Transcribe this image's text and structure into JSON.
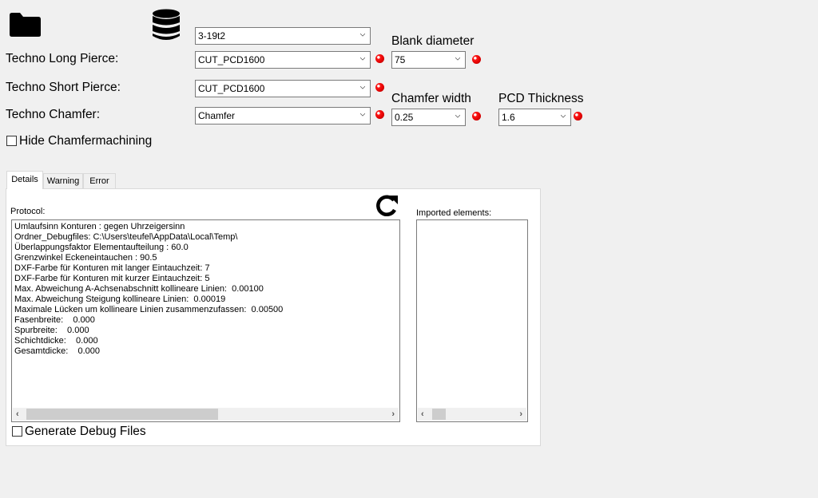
{
  "toolbar": {
    "folder_icon": "folder-icon",
    "database_icon": "database-icon"
  },
  "database_select": {
    "value": "3-19t2"
  },
  "fields": {
    "long_pierce": {
      "label": "Techno Long Pierce:",
      "value": "CUT_PCD1600"
    },
    "short_pierce": {
      "label": "Techno Short Pierce:",
      "value": "CUT_PCD1600"
    },
    "chamfer": {
      "label": "Techno Chamfer:",
      "value": "Chamfer"
    },
    "blank_diameter": {
      "label": "Blank diameter",
      "value": "75"
    },
    "chamfer_width": {
      "label": "Chamfer width",
      "value": "0.25"
    },
    "pcd_thickness": {
      "label": "PCD Thickness",
      "value": "1.6"
    }
  },
  "status_color": "#e00000",
  "hide_chamfer": {
    "label": "Hide Chamfermachining",
    "checked": false
  },
  "tabs": [
    {
      "label": "Details",
      "active": true
    },
    {
      "label": "Warning",
      "active": false
    },
    {
      "label": "Error",
      "active": false
    }
  ],
  "details": {
    "protocol_label": "Protocol:",
    "imported_label": "Imported elements:",
    "refresh_icon": "refresh-icon",
    "protocol_lines": [
      "Umlaufsinn Konturen : gegen Uhrzeigersinn",
      "Ordner_Debugfiles: C:\\Users\\teufel\\AppData\\Local\\Temp\\",
      "Überlappungsfaktor Elementaufteilung : 60.0",
      "Grenzwinkel Eckeneintauchen : 90.5",
      "DXF-Farbe für Konturen mit langer Eintauchzeit: 7",
      "DXF-Farbe für Konturen mit kurzer Eintauchzeit: 5",
      "Max. Abweichung A-Achsenabschnitt kollineare Linien:  0.00100",
      "Max. Abweichung Steigung kollineare Linien:  0.00019",
      "Maximale Lücken um kollineare Linien zusammenzufassen:  0.00500",
      "Fasenbreite:    0.000",
      "Spurbreite:    0.000",
      "Schichtdicke:    0.000",
      "Gesamtdicke:    0.000"
    ],
    "generate_debug": {
      "label": "Generate Debug Files",
      "checked": false
    }
  }
}
